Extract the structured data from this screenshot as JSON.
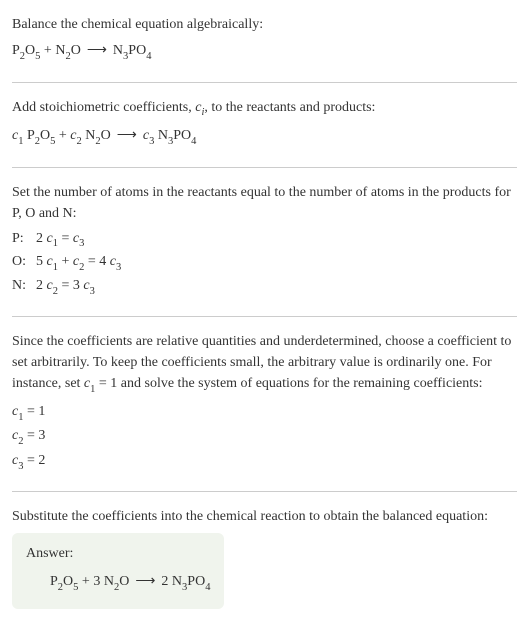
{
  "section1": {
    "title": "Balance the chemical equation algebraically:",
    "eq_lhs1": "P",
    "eq_lhs1_sub1": "2",
    "eq_lhs1_mid": "O",
    "eq_lhs1_sub2": "5",
    "eq_plus": " + ",
    "eq_lhs2": "N",
    "eq_lhs2_sub1": "2",
    "eq_lhs2_mid": "O",
    "arrow": "⟶",
    "eq_rhs": "N",
    "eq_rhs_sub1": "3",
    "eq_rhs_mid": "PO",
    "eq_rhs_sub2": "4"
  },
  "section2": {
    "title_part1": "Add stoichiometric coefficients, ",
    "title_c": "c",
    "title_i": "i",
    "title_part2": ", to the reactants and products:",
    "c1": "c",
    "c1_sub": "1",
    "sp": " ",
    "p": "P",
    "s2": "2",
    "o": "O",
    "s5": "5",
    "plus": " + ",
    "c2": "c",
    "c2_sub": "2",
    "n": "N",
    "arrow": "⟶",
    "c3": "c",
    "c3_sub": "3",
    "s3": "3",
    "po": "PO",
    "s4": "4"
  },
  "section3": {
    "title": "Set the number of atoms in the reactants equal to the number of atoms in the products for P, O and N:",
    "rows": [
      {
        "label": "P:",
        "lhs_coef": "2 ",
        "lhs_c": "c",
        "lhs_sub": "1",
        "eq": " = ",
        "rhs_c": "c",
        "rhs_sub": "3"
      },
      {
        "label": "O:",
        "lhs_coef": "5 ",
        "lhs_c": "c",
        "lhs_sub": "1",
        "plus": " + ",
        "lhs2_c": "c",
        "lhs2_sub": "2",
        "eq": " = ",
        "rhs_coef": "4 ",
        "rhs_c": "c",
        "rhs_sub": "3"
      },
      {
        "label": "N:",
        "lhs_coef": "2 ",
        "lhs_c": "c",
        "lhs_sub": "2",
        "eq": " = ",
        "rhs_coef": "3 ",
        "rhs_c": "c",
        "rhs_sub": "3"
      }
    ]
  },
  "section4": {
    "text_part1": "Since the coefficients are relative quantities and underdetermined, choose a coefficient to set arbitrarily. To keep the coefficients small, the arbitrary value is ordinarily one. For instance, set ",
    "c": "c",
    "c_sub": "1",
    "text_part2": " = 1 and solve the system of equations for the remaining coefficients:",
    "coeffs": [
      {
        "c": "c",
        "sub": "1",
        "val": " = 1"
      },
      {
        "c": "c",
        "sub": "2",
        "val": " = 3"
      },
      {
        "c": "c",
        "sub": "3",
        "val": " = 2"
      }
    ]
  },
  "section5": {
    "title": "Substitute the coefficients into the chemical reaction to obtain the balanced equation:",
    "answer_label": "Answer:",
    "p": "P",
    "s2": "2",
    "o": "O",
    "s5": "5",
    "plus": " + 3 ",
    "n": "N",
    "arrow": "⟶",
    "two": "2 ",
    "s3": "3",
    "po": "PO",
    "s4": "4"
  }
}
